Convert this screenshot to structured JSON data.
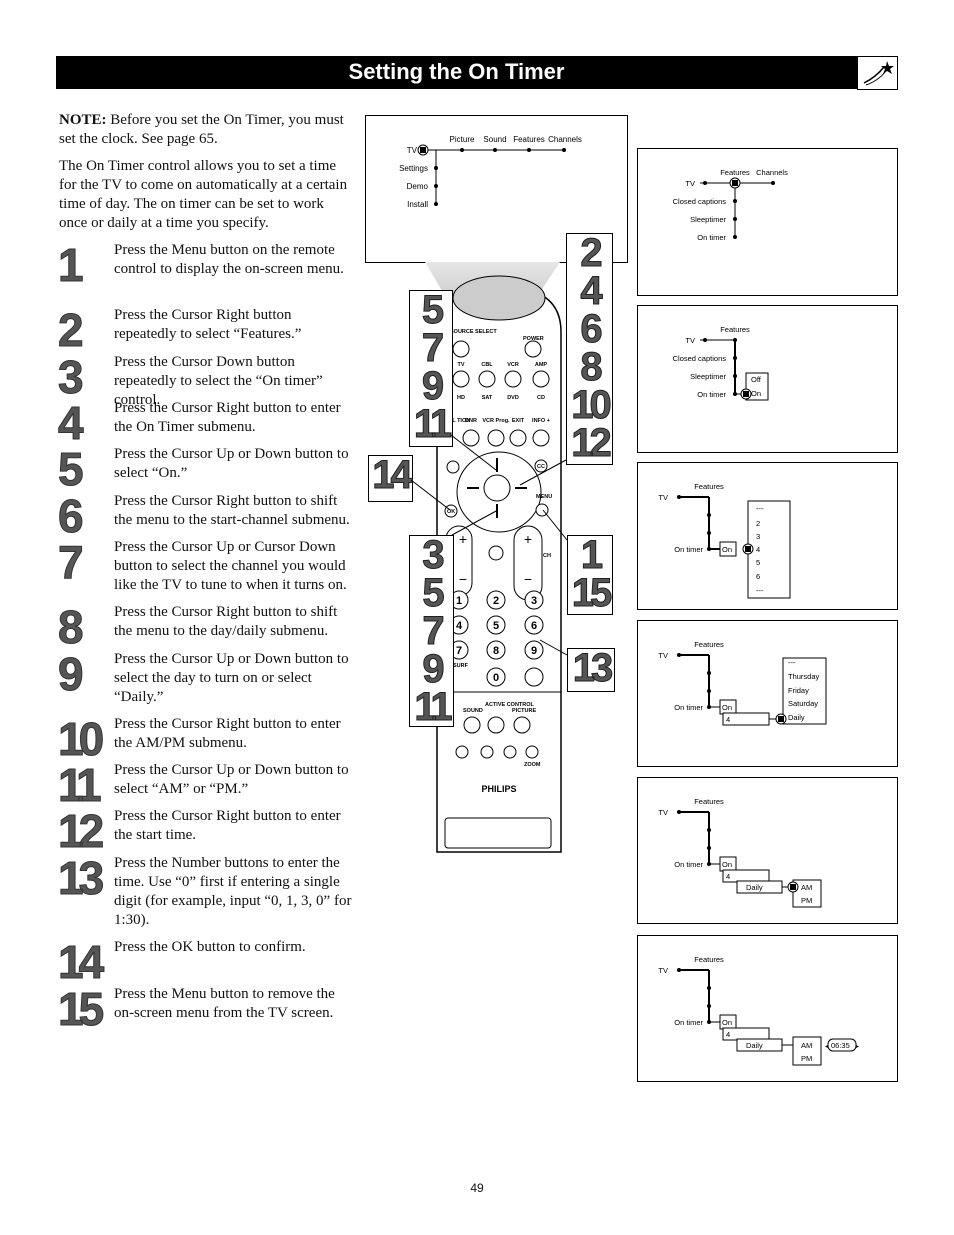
{
  "header": {
    "title": "Setting the On Timer",
    "icon": "shooting-star-icon"
  },
  "intro": {
    "note_label": "NOTE:",
    "note_text": " Before you set the On Timer, you must set the clock.  See page 65.",
    "description": "The On Timer control allows you to set a time for the TV to come on automatically at a certain time of day. The on timer can be set to work once or daily at a time you specify."
  },
  "steps": [
    {
      "n": "1",
      "text": "Press the Menu button on the remote control to display the on-screen menu."
    },
    {
      "n": "2",
      "text": "Press the Cursor Right button repeatedly to select “Features.”"
    },
    {
      "n": "3",
      "text": "Press the Cursor Down button repeatedly to select the “On timer” control."
    },
    {
      "n": "4",
      "text": "Press the Cursor Right button to enter the On Timer submenu."
    },
    {
      "n": "5",
      "text": "Press the Cursor Up or Down button to select “On.”"
    },
    {
      "n": "6",
      "text": "Press the Cursor Right button to shift the menu to the start-channel submenu."
    },
    {
      "n": "7",
      "text": "Press the Cursor Up or Cursor Down button to select the channel you would like the TV to tune to when it turns on."
    },
    {
      "n": "8",
      "text": "Press the Cursor Right button to shift the menu to the day/daily submenu."
    },
    {
      "n": "9",
      "text": "Press the Cursor Up or Down button to select the day to turn on or select “Daily.”"
    },
    {
      "n": "10",
      "text": "Press the Cursor Right button to enter the AM/PM submenu."
    },
    {
      "n": "11",
      "text": "Press the Cursor Up or Down button to select “AM” or “PM.”"
    },
    {
      "n": "12",
      "text": "Press the Cursor Right button to enter the start time."
    },
    {
      "n": "13",
      "text": "Press the Number buttons to enter the time. Use “0” first if entering a single digit (for example, input “0, 1, 3, 0” for 1:30)."
    },
    {
      "n": "14",
      "text": "Press the OK button to confirm."
    },
    {
      "n": "15",
      "text": "Press the Menu button to remove the on-screen menu from the TV screen."
    }
  ],
  "tv_menu": {
    "root": "TV",
    "top": [
      "Picture",
      "Sound",
      "Features",
      "Channels"
    ],
    "side": [
      "Settings",
      "Demo",
      "Install"
    ]
  },
  "menu_features": {
    "root": "TV",
    "top": [
      "Features",
      "Channels"
    ],
    "side": [
      "Closed  captions",
      "Sleeptimer",
      "On  timer"
    ]
  },
  "menu_ontimer": {
    "root": "TV",
    "top": "Features",
    "side": [
      "Closed  captions",
      "Sleeptimer",
      "On  timer"
    ],
    "options": [
      "Off",
      "On"
    ]
  },
  "menu_channel": {
    "root": "TV",
    "top": "Features",
    "label": "On  timer",
    "state": "On",
    "channels": [
      "---",
      "2",
      "3",
      "4",
      "5",
      "6",
      "---"
    ]
  },
  "menu_day": {
    "root": "TV",
    "top": "Features",
    "label": "On  timer",
    "state": "On",
    "channel": "4",
    "days": [
      "---",
      "Thursday",
      "Friday",
      "Saturday",
      "Daily"
    ]
  },
  "menu_ampm": {
    "root": "TV",
    "top": "Features",
    "label": "On  timer",
    "state": "On",
    "channel": "4",
    "day": "Daily",
    "ampm": [
      "AM",
      "PM"
    ]
  },
  "menu_time": {
    "root": "TV",
    "top": "Features",
    "label": "On  timer",
    "state": "On",
    "channel": "4",
    "day": "Daily",
    "ampm": [
      "AM",
      "PM"
    ],
    "time": "06:35"
  },
  "callouts": {
    "right_top": [
      "2",
      "4",
      "6",
      "8",
      "10",
      "12"
    ],
    "left_top": [
      "5",
      "7",
      "9",
      "11"
    ],
    "ok": "14",
    "menu": [
      "1",
      "15"
    ],
    "left_bottom": [
      "3",
      "5",
      "7",
      "9",
      "11"
    ],
    "numbers": "13"
  },
  "remote": {
    "brand": "PHILIPS",
    "source_select": "SOURCE SELECT",
    "power": "POWER",
    "row1": [
      "TV",
      "CBL",
      "VCR",
      "AMP"
    ],
    "row2": [
      "HD",
      "SAT",
      "DVD",
      "CD"
    ],
    "row3": [
      "DNR",
      "VCR Prog.",
      "EXIT",
      "INFO +"
    ],
    "natural": "TURAL TION",
    "cc": "CC",
    "ok": "OK",
    "menu": "MENU",
    "ch": "CH",
    "digits": [
      "1",
      "2",
      "3",
      "4",
      "5",
      "6",
      "7",
      "8",
      "9",
      "0"
    ],
    "surf": "SURF",
    "sound": "SOUND",
    "active_control": "ACTIVE CONTROL",
    "picture": "PICTURE",
    "zoom": "ZOOM"
  },
  "page_number": "49"
}
